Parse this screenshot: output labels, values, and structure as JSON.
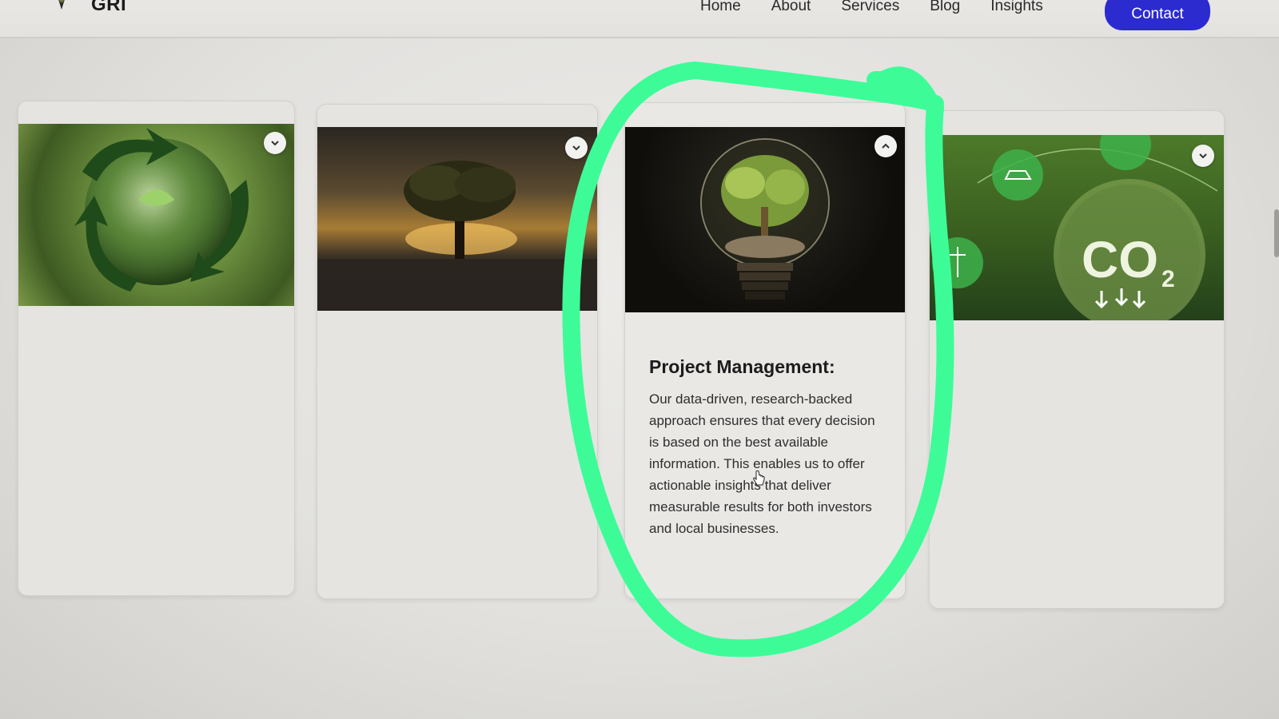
{
  "header": {
    "logo_text": "GRI",
    "nav": [
      "Home",
      "About",
      "Services",
      "Blog",
      "Insights"
    ],
    "contact_label": "Contact"
  },
  "cards": [
    {
      "image": "recycling-earth-image",
      "expanded": false
    },
    {
      "image": "tree-sunset-image",
      "expanded": false
    },
    {
      "image": "tree-lightbulb-image",
      "expanded": true,
      "title": "Project Management:",
      "body": "Our data-driven, research-backed approach ensures that every decision is based on the best available information. This enables us to offer actionable insights that deliver measurable results for both investors and local businesses."
    },
    {
      "image": "co2-globe-image",
      "image_text": "CO",
      "image_subscript": "2",
      "expanded": false
    }
  ],
  "colors": {
    "accent": "#2b2bd0",
    "annotation": "#3dfc98",
    "background": "#e2e1de"
  }
}
